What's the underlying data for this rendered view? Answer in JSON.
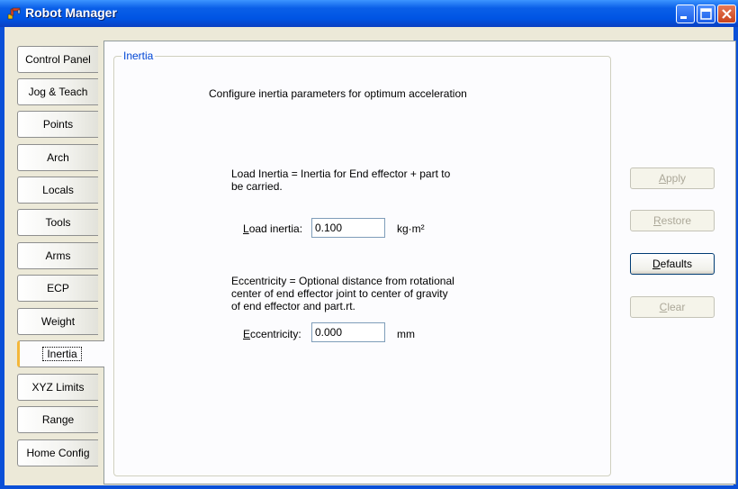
{
  "window": {
    "title": "Robot Manager"
  },
  "tabs": [
    {
      "label": "Control Panel"
    },
    {
      "label": "Jog & Teach"
    },
    {
      "label": "Points"
    },
    {
      "label": "Arch"
    },
    {
      "label": "Locals"
    },
    {
      "label": "Tools"
    },
    {
      "label": "Arms"
    },
    {
      "label": "ECP"
    },
    {
      "label": "Weight"
    },
    {
      "label": "Inertia"
    },
    {
      "label": "XYZ Limits"
    },
    {
      "label": "Range"
    },
    {
      "label": "Home Config"
    }
  ],
  "active_tab": "Inertia",
  "group": {
    "legend": "Inertia",
    "description": "Configure inertia parameters for optimum acceleration",
    "load_note_line1": "Load Inertia = Inertia for End effector + part to",
    "load_note_line2": "be carried.",
    "load_inertia": {
      "label_first": "L",
      "label_rest": "oad inertia:",
      "value": "0.100",
      "unit": "kg·m²"
    },
    "ecc_note_line1": "Eccentricity = Optional distance from rotational",
    "ecc_note_line2": "center of end effector joint to center of gravity",
    "ecc_note_line3": "of end effector and part.rt.",
    "eccentricity": {
      "label_first": "E",
      "label_rest": "ccentricity:",
      "value": "0.000",
      "unit": "mm"
    }
  },
  "buttons": {
    "apply": {
      "first": "A",
      "rest": "pply"
    },
    "restore": {
      "first": "R",
      "rest": "estore"
    },
    "defaults": {
      "first": "D",
      "rest": "efaults"
    },
    "clear": {
      "first": "C",
      "rest": "lear"
    }
  },
  "colors": {
    "titlebar": "#0054e3",
    "legend": "#0046d5",
    "active_tab_accent": "#f4b73a"
  }
}
